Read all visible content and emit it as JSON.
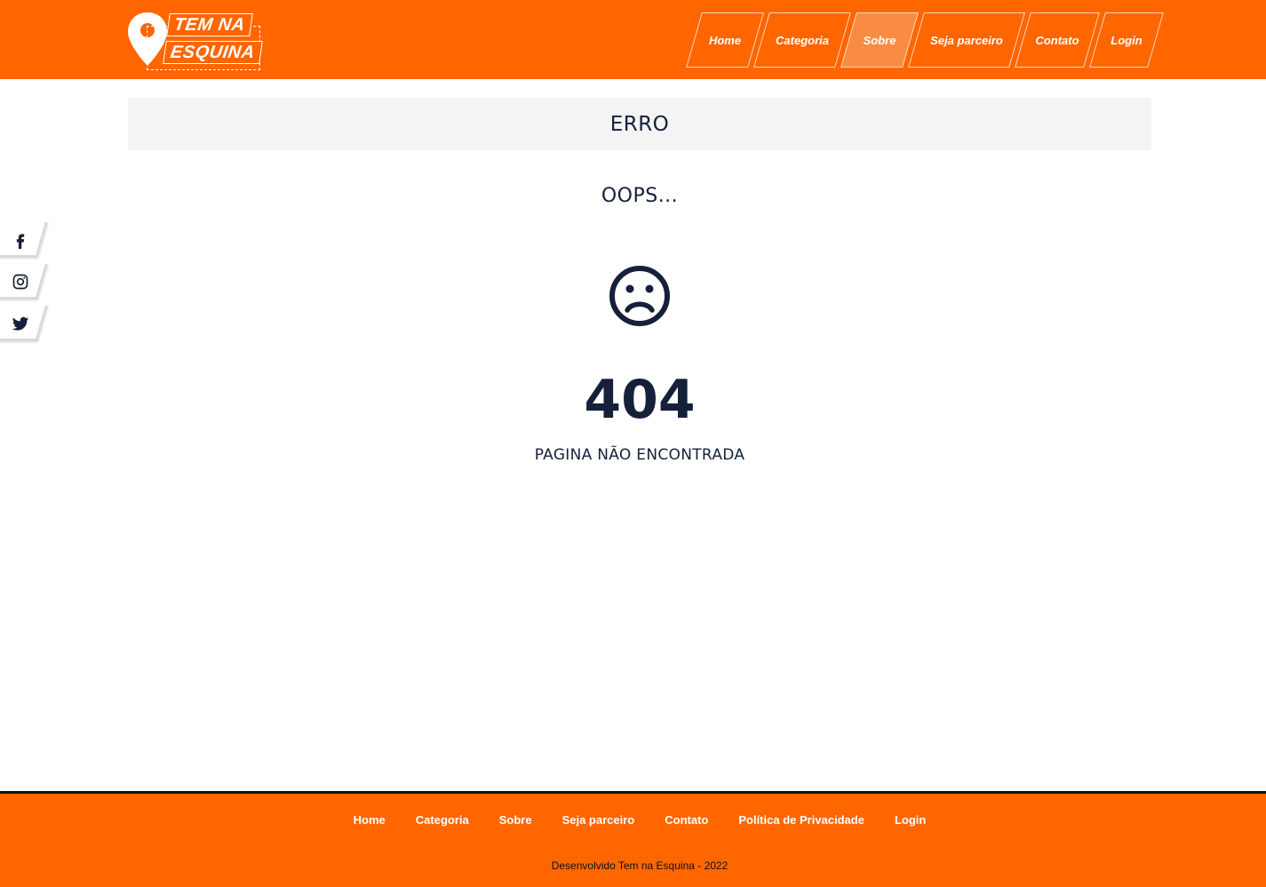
{
  "colors": {
    "brand": "#ff6600",
    "nav_active": "#f98c44",
    "text_dark": "#15203a"
  },
  "header": {
    "logo": {
      "line1": "TEM NA",
      "line2": "ESQUINA"
    },
    "nav": [
      {
        "label": "Home",
        "active": false
      },
      {
        "label": "Categoria",
        "active": false
      },
      {
        "label": "Sobre",
        "active": true
      },
      {
        "label": "Seja parceiro",
        "active": false
      },
      {
        "label": "Contato",
        "active": false
      },
      {
        "label": "Login",
        "active": false
      }
    ]
  },
  "social": [
    {
      "icon": "facebook-icon"
    },
    {
      "icon": "instagram-icon"
    },
    {
      "icon": "twitter-icon"
    }
  ],
  "main": {
    "title": "ERRO",
    "oops": "OOPS...",
    "icon": "sad-face-icon",
    "code": "404",
    "message": "PAGINA NÃO ENCONTRADA"
  },
  "footer": {
    "links": [
      "Home",
      "Categoria",
      "Sobre",
      "Seja parceiro",
      "Contato",
      "Política de Privacidade",
      "Login"
    ],
    "copyright": "Desenvolvido Tem na Esquina - 2022"
  }
}
